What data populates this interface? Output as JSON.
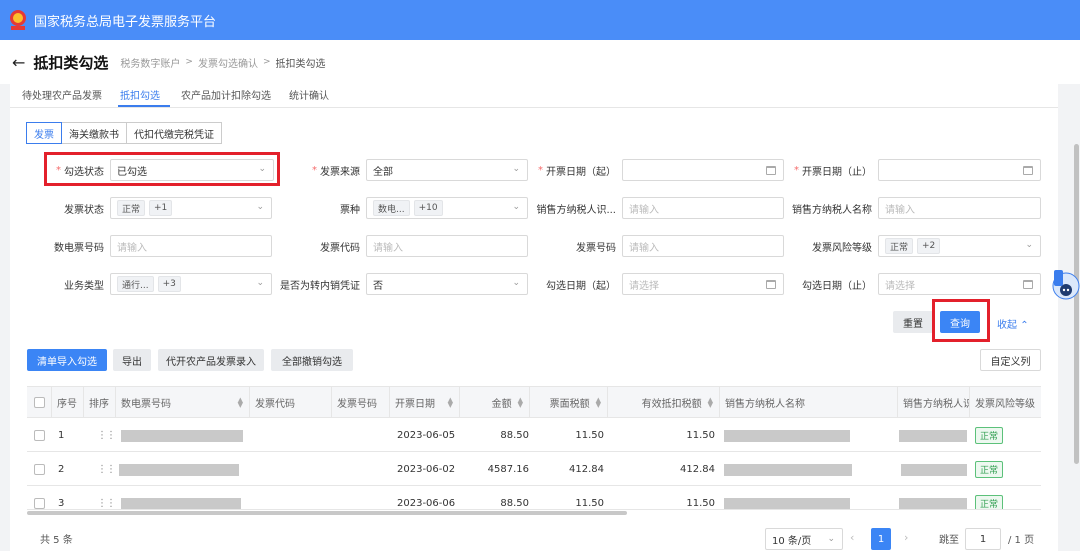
{
  "topbar": {
    "title": "国家税务总局电子发票服务平台"
  },
  "header": {
    "back_icon": "←",
    "title": "抵扣类勾选",
    "breadcrumb": [
      "税务数字账户",
      "发票勾选确认",
      "抵扣类勾选"
    ]
  },
  "tabs": [
    "待处理农产品发票",
    "抵扣勾选",
    "农产品加计扣除勾选",
    "统计确认"
  ],
  "subtabs": [
    "发票",
    "海关缴款书",
    "代扣代缴完税凭证"
  ],
  "form": {
    "r1": {
      "select_status_label": "勾选状态",
      "select_status_value": "已勾选",
      "source_label": "发票来源",
      "source_value": "全部",
      "date_from_label": "开票日期（起）",
      "date_to_label": "开票日期（止）"
    },
    "r2": {
      "invoice_status_label": "发票状态",
      "invoice_status_tag": "正常",
      "invoice_status_more": "+1",
      "type_label": "票种",
      "type_tag": "数电...",
      "type_more": "+10",
      "seller_id_label": "销售方纳税人识...",
      "seller_id_ph": "请输入",
      "seller_name_label": "销售方纳税人名称",
      "seller_name_ph": "请输入"
    },
    "r3": {
      "digital_no_label": "数电票号码",
      "digital_no_ph": "请输入",
      "code_label": "发票代码",
      "code_ph": "请输入",
      "number_label": "发票号码",
      "number_ph": "请输入",
      "risk_label": "发票风险等级",
      "risk_tag": "正常",
      "risk_more": "+2"
    },
    "r4": {
      "biz_label": "业务类型",
      "biz_tag": "通行...",
      "biz_more": "+3",
      "transfer_label": "是否为转内销凭证",
      "transfer_value": "否",
      "sel_from_label": "勾选日期（起）",
      "sel_from_ph": "请选择",
      "sel_to_label": "勾选日期（止）",
      "sel_to_ph": "请选择"
    }
  },
  "actions": {
    "reset": "重置",
    "query": "查询",
    "collapse": "收起"
  },
  "toolbar": {
    "import": "清单导入勾选",
    "export": "导出",
    "agri": "代开农产品发票录入",
    "cancel_all": "全部撤销勾选",
    "custom": "自定义列"
  },
  "table": {
    "headers": [
      "序号",
      "排序",
      "数电票号码",
      "发票代码",
      "发票号码",
      "开票日期",
      "金额",
      "票面税额",
      "有效抵扣税额",
      "销售方纳税人名称",
      "销售方纳税人识别号",
      "发票风险等级"
    ],
    "rows": [
      {
        "seq": "1",
        "date": "2023-06-05",
        "amount": "88.50",
        "tax": "11.50",
        "valid_tax": "11.50",
        "risk": "正常"
      },
      {
        "seq": "2",
        "date": "2023-06-02",
        "amount": "4587.16",
        "tax": "412.84",
        "valid_tax": "412.84",
        "risk": "正常"
      },
      {
        "seq": "3",
        "date": "2023-06-06",
        "amount": "88.50",
        "tax": "11.50",
        "valid_tax": "11.50",
        "risk": "正常"
      }
    ]
  },
  "pagination": {
    "total": "共 5 条",
    "page_size": "10 条/页",
    "current": "1",
    "jump_label": "跳至",
    "jump_value": "1",
    "page_total": "/ 1 页"
  },
  "colors": {
    "brand": "#4a8df8",
    "primary": "#3b85f5",
    "highlight": "#e3202b",
    "success": "#2f9e4f"
  }
}
